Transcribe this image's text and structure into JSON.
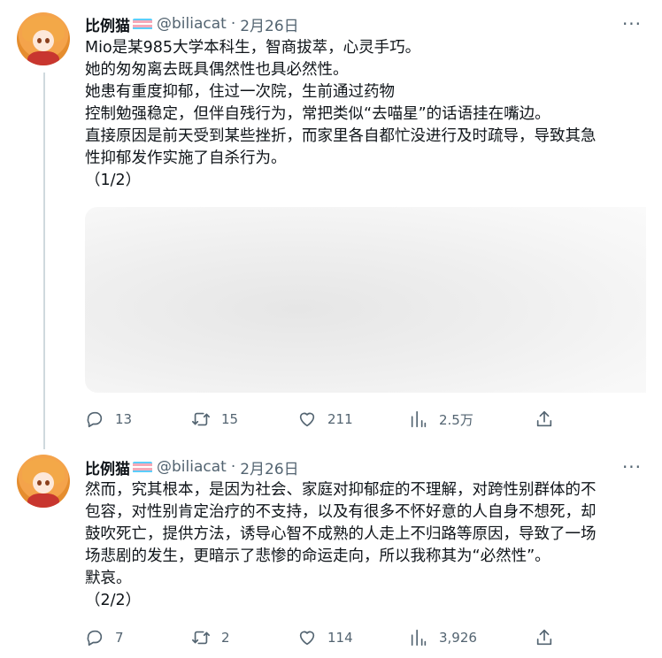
{
  "colors": {
    "text": "#0f1419",
    "muted": "#536471",
    "thread_line": "#cfd9de",
    "flag_stripes": [
      "#5bcefa",
      "#f5a9b8",
      "#ffffff",
      "#f5a9b8",
      "#5bcefa"
    ]
  },
  "tweets": [
    {
      "author": {
        "name": "比例猫",
        "handle": "@biliacat",
        "avatar_icon": "anime-girl-avatar",
        "flag_icon": "transgender-flag-icon"
      },
      "separator": "·",
      "date": "2月26日",
      "more_label": "···",
      "lines": [
        "Mio是某985大学本科生，智商拔萃，心灵手巧。",
        "她的匆匆离去既具偶然性也具必然性。",
        "她患有重度抑郁，住过一次院，生前通过药物",
        "控制勉强稳定，但伴自残行为，常把类似“去喵星”的话语挂在嘴边。",
        "直接原因是前天受到某些挫折，而家里各自都忙没进行及时疏导，导致其急",
        "性抑郁发作实施了自杀行为。",
        "（1/2）"
      ],
      "media": "blurred-image",
      "actions": {
        "replies": "13",
        "retweets": "15",
        "likes": "211",
        "views": "2.5万"
      }
    },
    {
      "author": {
        "name": "比例猫",
        "handle": "@biliacat",
        "avatar_icon": "anime-girl-avatar",
        "flag_icon": "transgender-flag-icon"
      },
      "separator": "·",
      "date": "2月26日",
      "more_label": "···",
      "lines": [
        "然而，究其根本，是因为社会、家庭对抑郁症的不理解，对跨性别群体的不",
        "包容，对性别肯定治疗的不支持，以及有很多不怀好意的人自身不想死，却",
        "鼓吹死亡，提供方法，诱导心智不成熟的人走上不归路等原因，导致了一场",
        "场悲剧的发生，更暗示了悲惨的命运走向，所以我称其为“必然性”。",
        "默哀。",
        "（2/2）"
      ],
      "actions": {
        "replies": "7",
        "retweets": "2",
        "likes": "114",
        "views": "3,926"
      }
    }
  ]
}
